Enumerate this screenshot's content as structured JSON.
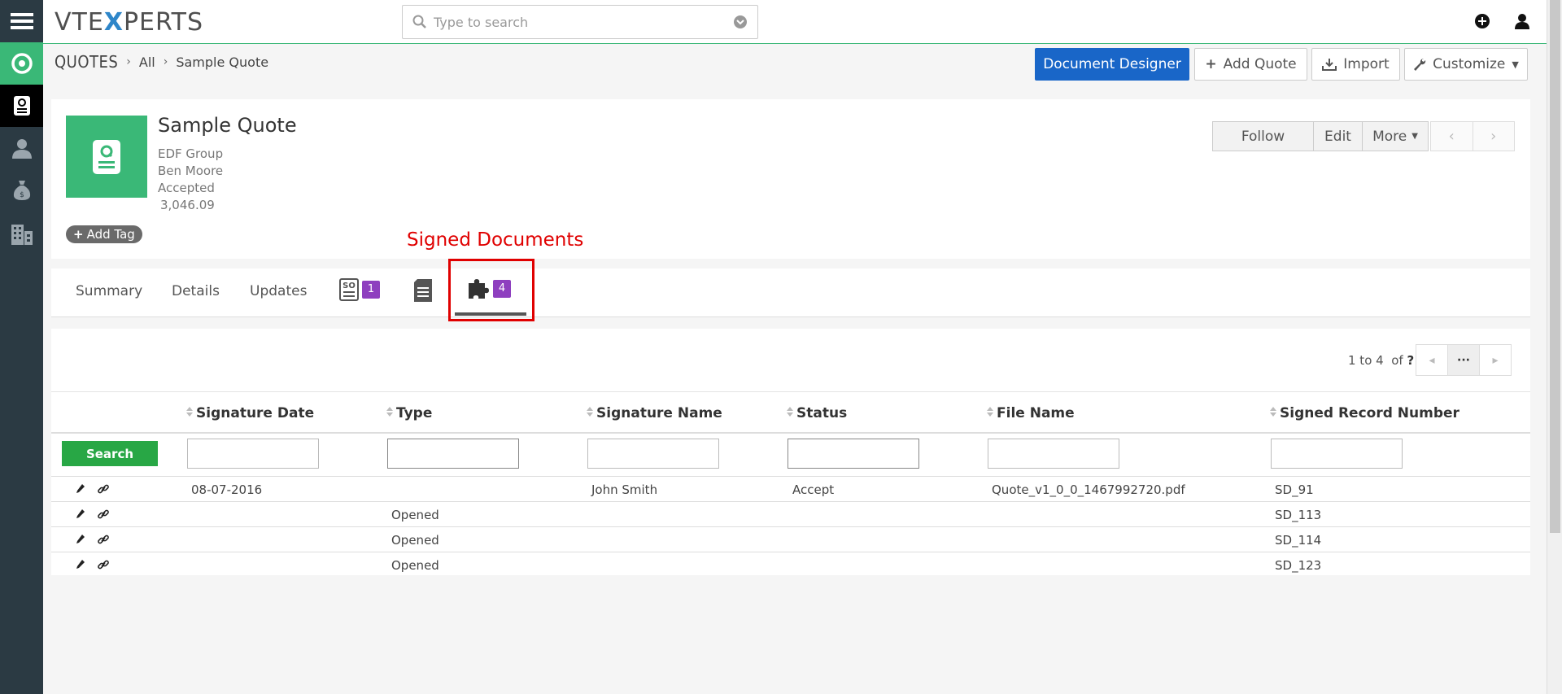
{
  "header": {
    "logo_prefix": "VTE",
    "logo_x": "X",
    "logo_suffix": "PERTS",
    "search_placeholder": "Type to search"
  },
  "sidebar": {
    "items": [
      {
        "icon": "hamburger-menu-icon"
      },
      {
        "icon": "home-circle-icon",
        "active_color": "#3ab877"
      },
      {
        "icon": "quotes-icon"
      },
      {
        "icon": "contacts-icon"
      },
      {
        "icon": "money-bag-icon"
      },
      {
        "icon": "organizations-icon"
      }
    ]
  },
  "breadcrumb": {
    "module": "QUOTES",
    "all": "All",
    "record": "Sample Quote"
  },
  "toolbar": {
    "document_designer": "Document Designer",
    "add_quote": "Add Quote",
    "import": "Import",
    "customize": "Customize"
  },
  "record": {
    "title": "Sample Quote",
    "organization": "EDF Group",
    "contact": "Ben Moore",
    "stage": "Accepted",
    "total": "3,046.09",
    "add_tag": "Add Tag"
  },
  "record_actions": {
    "follow": "Follow",
    "edit": "Edit",
    "more": "More"
  },
  "annotation": {
    "label": "Signed Documents",
    "color": "#e00000"
  },
  "tabs": {
    "summary": "Summary",
    "details": "Details",
    "updates": "Updates",
    "sales_orders_badge": "1",
    "signed_documents_badge": "4"
  },
  "related_list": {
    "paging_range": "1 to 4",
    "paging_of": "of",
    "paging_total": "?",
    "more_label": "···",
    "search_button": "Search",
    "columns": [
      "Signature Date",
      "Type",
      "Signature Name",
      "Status",
      "File Name",
      "Signed Record Number"
    ],
    "rows": [
      {
        "date": "08-07-2016",
        "type": "",
        "name": "John Smith",
        "status": "Accept",
        "file": "Quote_v1_0_0_1467992720.pdf",
        "number": "SD_91"
      },
      {
        "date": "",
        "type": "Opened",
        "name": "",
        "status": "",
        "file": "",
        "number": "SD_113"
      },
      {
        "date": "",
        "type": "Opened",
        "name": "",
        "status": "",
        "file": "",
        "number": "SD_114"
      },
      {
        "date": "",
        "type": "Opened",
        "name": "",
        "status": "",
        "file": "",
        "number": "SD_123"
      }
    ]
  },
  "colors": {
    "accent_green": "#3ab877",
    "primary_blue": "#1966c8",
    "search_green": "#28a745",
    "badge_purple": "#8e3fbf",
    "rail_dark": "#2b3a43"
  }
}
